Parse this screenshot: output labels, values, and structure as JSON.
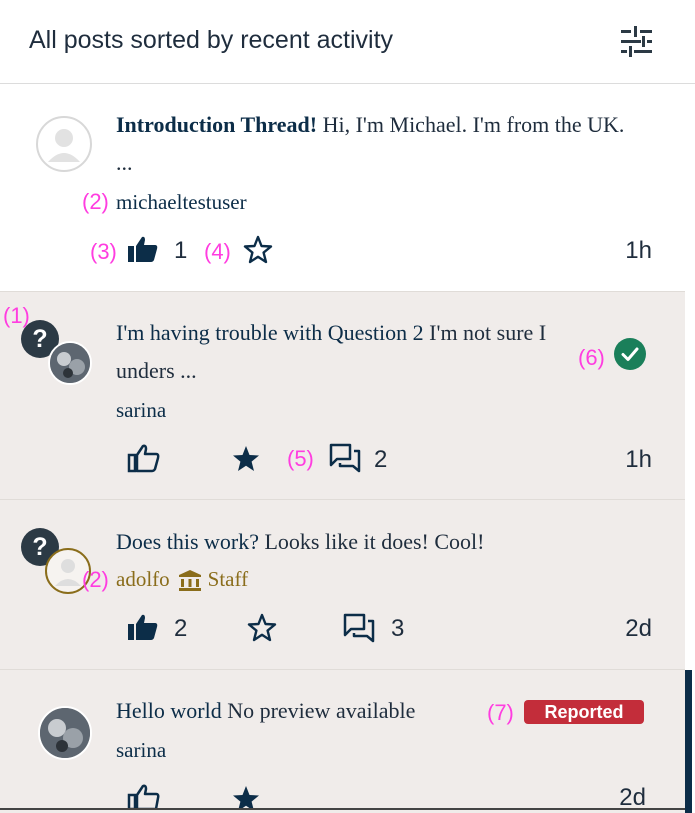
{
  "header": {
    "title": "All posts sorted by recent activity",
    "filter_icon": "sliders-icon"
  },
  "markers": {
    "m1": "(1)",
    "m2a": "(2)",
    "m2b": "(2)",
    "m3": "(3)",
    "m4": "(4)",
    "m5": "(5)",
    "m6": "(6)",
    "m7": "(7)"
  },
  "posts": [
    {
      "title": "Introduction Thread!",
      "preview": " Hi, I'm Michael. I'm from the UK. ...",
      "author": "michaeltestuser",
      "likes": "1",
      "time": "1h",
      "liked": true,
      "starred": false
    },
    {
      "title": "I'm having trouble with Question 2",
      "preview": " I'm not sure I unders ...",
      "author": "sarina",
      "comments": "2",
      "time": "1h",
      "liked": false,
      "starred": true,
      "answered": true,
      "type": "question"
    },
    {
      "title": "Does this work?",
      "preview": " Looks like it does! Cool!",
      "author": "adolfo",
      "role": "Staff",
      "likes": "2",
      "comments": "3",
      "time": "2d",
      "liked": true,
      "starred": false,
      "type": "question"
    },
    {
      "title": "Hello world",
      "preview": " No preview available",
      "author": "sarina",
      "status": "Reported",
      "time": "2d",
      "liked": false,
      "starred": true
    }
  ],
  "colors": {
    "accent": "#0c2d48",
    "staff": "#8a6d1b",
    "reported": "#c32d3a",
    "success": "#1a7f5a",
    "marker": "#ff3de0"
  }
}
